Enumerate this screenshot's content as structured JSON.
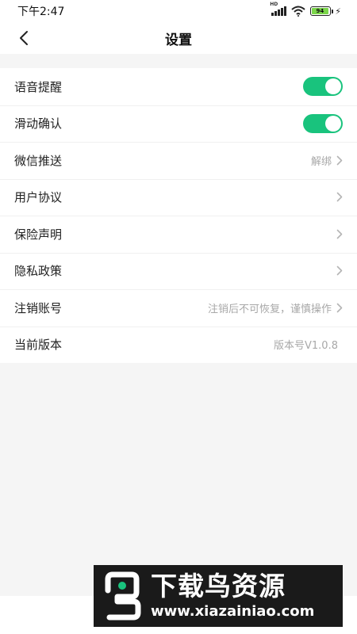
{
  "status_bar": {
    "time": "下午2:47",
    "network": "HD",
    "battery_level": "94"
  },
  "header": {
    "title": "设置"
  },
  "settings": [
    {
      "label": "语音提醒",
      "type": "toggle",
      "on": true
    },
    {
      "label": "滑动确认",
      "type": "toggle",
      "on": true
    },
    {
      "label": "微信推送",
      "type": "link",
      "value": "解绑"
    },
    {
      "label": "用户协议",
      "type": "link",
      "value": ""
    },
    {
      "label": "保险声明",
      "type": "link",
      "value": ""
    },
    {
      "label": "隐私政策",
      "type": "link",
      "value": ""
    },
    {
      "label": "注销账号",
      "type": "link",
      "value": "注销后不可恢复，谨慎操作"
    },
    {
      "label": "当前版本",
      "type": "text",
      "value": "版本号V1.0.8"
    }
  ],
  "watermark": {
    "title": "下载鸟资源",
    "url": "www.xiazainiao.com"
  },
  "colors": {
    "toggle_on": "#19c37d",
    "background": "#f5f5f5",
    "secondary_text": "#a8a8a8"
  },
  "icons": {
    "back": "chevron-left-icon",
    "row_arrow": "chevron-right-icon"
  }
}
